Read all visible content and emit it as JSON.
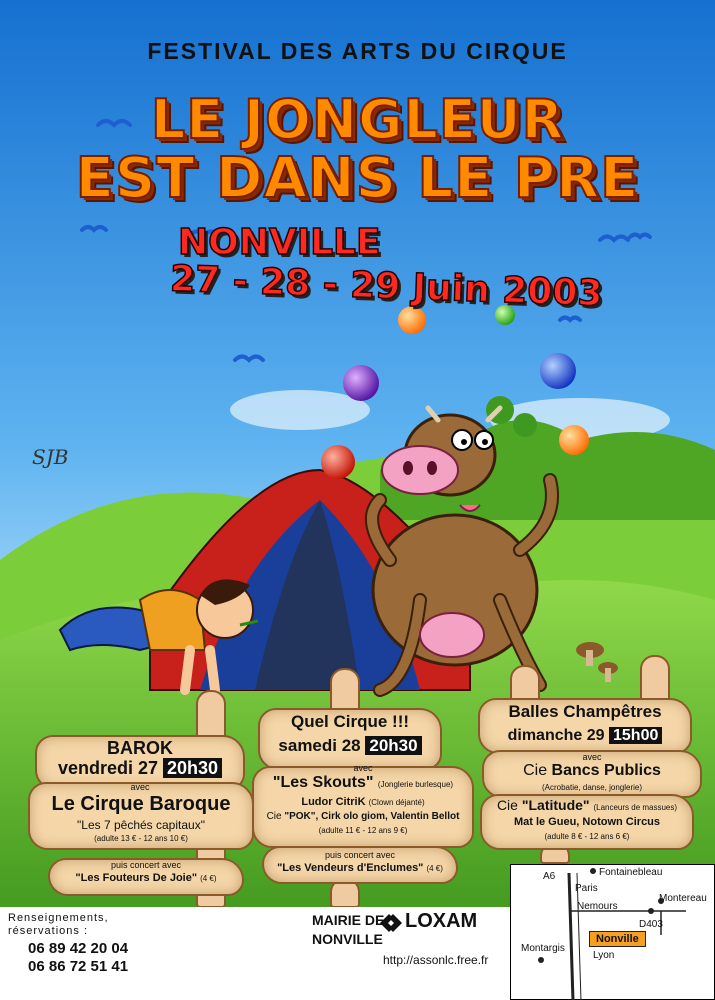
{
  "header": "FESTIVAL DES ARTS DU CIRQUE",
  "title_line1": "LE JONGLEUR",
  "title_line2": "EST DANS LE PRE",
  "town": "NONVILLE",
  "dates": "27 - 28 - 29 Juin 2003",
  "signature": "SJB",
  "colors": {
    "sky_top": "#1a7fd6",
    "sky_bottom": "#cfeaff",
    "grass": "#58b82a",
    "title": "#ff8a00",
    "dates": "#ff2a1f",
    "sign": "#f4d6a8"
  },
  "sign1": {
    "title": "BAROK",
    "day": "vendredi 27",
    "time": "20h30",
    "avec": "avec",
    "act": "Le Cirque Baroque",
    "show": "\"Les 7 pêchés capitaux\"",
    "price": "(adulte 13 € - 12 ans 10 €)",
    "concert_intro": "puis concert avec",
    "concert": "\"Les Fouteurs De Joie\"",
    "concert_price": "(4 €)"
  },
  "sign2": {
    "title": "Quel Cirque !!!",
    "day": "samedi 28",
    "time": "20h30",
    "avec": "avec",
    "act": "\"Les Skouts\"",
    "act_note": "(Jonglerie burlesque)",
    "act2": "Ludor CitriK",
    "act2_note": "(Clown déjanté)",
    "act3_prefix": "Cie",
    "act3": "\"POK\", Cirk olo giom, Valentin Bellot",
    "price": "(adulte 11 € - 12 ans 9 €)",
    "concert_intro": "puis concert avec",
    "concert": "\"Les Vendeurs d'Enclumes\"",
    "concert_price": "(4 €)"
  },
  "sign3": {
    "title": "Balles Champêtres",
    "day": "dimanche 29",
    "time": "15h00",
    "avec": "avec",
    "cie1_prefix": "Cie",
    "cie1": "Bancs Publics",
    "cie1_note": "(Acrobatie, danse, jonglerie)",
    "cie2_prefix": "Cie",
    "cie2": "\"Latitude\"",
    "cie2_note": "(Lanceurs de massues)",
    "act": "Mat le Gueu,  Notown Circus",
    "price": "(adulte 8 € - 12 ans 6 €)"
  },
  "footer": {
    "info_label_1": "Renseignements,",
    "info_label_2": "réservations :",
    "phone1": "06 89 42 20 04",
    "phone2": "06 86 72 51 41",
    "mairie_1": "MAIRIE DE",
    "mairie_2": "NONVILLE",
    "sponsor": "LOXAM",
    "url": "http://assonlc.free.fr"
  },
  "map": {
    "a6": "A6",
    "paris": "Paris",
    "fontainebleau": "Fontainebleau",
    "nemours": "Nemours",
    "montereau": "Montereau",
    "d403": "D403",
    "nonville": "Nonville",
    "montargis": "Montargis",
    "lyon": "Lyon"
  }
}
